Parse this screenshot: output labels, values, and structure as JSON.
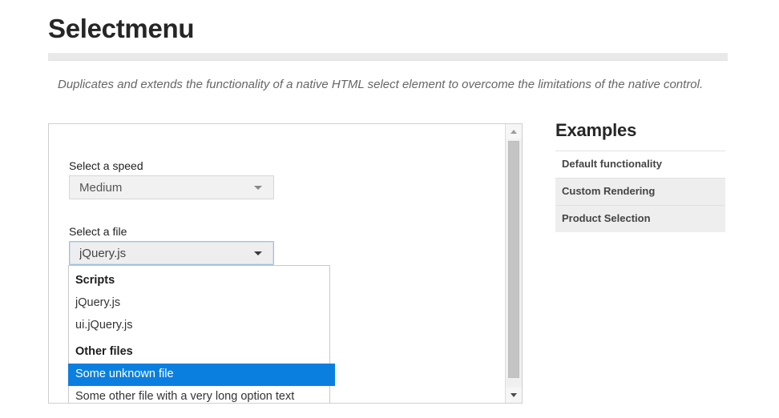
{
  "header": {
    "title": "Selectmenu",
    "description": "Duplicates and extends the functionality of a native HTML select element to overcome the limitations of the native control."
  },
  "demo": {
    "speed": {
      "label": "Select a speed",
      "value": "Medium",
      "caret_icon": "chevron-down-icon"
    },
    "file": {
      "label": "Select a file",
      "value": "jQuery.js",
      "caret_icon": "chevron-down-icon",
      "focused": true
    },
    "menu": {
      "groups": [
        {
          "label": "Scripts",
          "options": [
            {
              "text": "jQuery.js",
              "selected": false
            },
            {
              "text": "ui.jQuery.js",
              "selected": false
            }
          ]
        },
        {
          "label": "Other files",
          "options": [
            {
              "text": "Some unknown file",
              "selected": true
            },
            {
              "text": "Some other file with a very long option text",
              "selected": false
            }
          ]
        }
      ]
    },
    "scrollbar": {
      "up_icon": "triangle-up-icon",
      "down_icon": "triangle-down-icon"
    }
  },
  "sidebar": {
    "title": "Examples",
    "items": [
      {
        "label": "Default functionality",
        "shaded": false
      },
      {
        "label": "Custom Rendering",
        "shaded": true
      },
      {
        "label": "Product Selection",
        "shaded": true
      }
    ]
  },
  "colors": {
    "highlight": "#0b7fe0",
    "focus_border": "#9cc0e0",
    "text": "#262626"
  }
}
